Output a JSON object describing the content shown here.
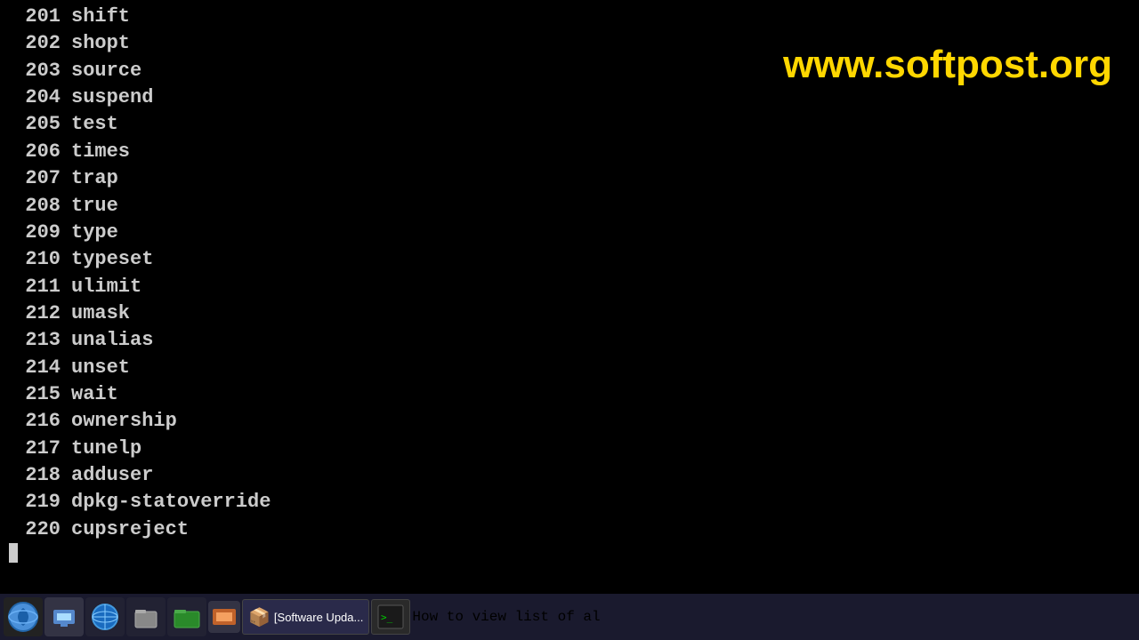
{
  "watermark": "www.softpost.org",
  "terminal": {
    "lines": [
      {
        "num": "201",
        "cmd": "shift"
      },
      {
        "num": "202",
        "cmd": "shopt"
      },
      {
        "num": "203",
        "cmd": "source"
      },
      {
        "num": "204",
        "cmd": "suspend"
      },
      {
        "num": "205",
        "cmd": "test"
      },
      {
        "num": "206",
        "cmd": "times"
      },
      {
        "num": "207",
        "cmd": "trap"
      },
      {
        "num": "208",
        "cmd": "true"
      },
      {
        "num": "209",
        "cmd": "type"
      },
      {
        "num": "210",
        "cmd": "typeset"
      },
      {
        "num": "211",
        "cmd": "ulimit"
      },
      {
        "num": "212",
        "cmd": "umask"
      },
      {
        "num": "213",
        "cmd": "unalias"
      },
      {
        "num": "214",
        "cmd": "unset"
      },
      {
        "num": "215",
        "cmd": "wait"
      },
      {
        "num": "216",
        "cmd": "ownership"
      },
      {
        "num": "217",
        "cmd": "tunelp"
      },
      {
        "num": "218",
        "cmd": "adduser"
      },
      {
        "num": "219",
        "cmd": "dpkg-statoverride"
      },
      {
        "num": "220",
        "cmd": "cupsreject"
      }
    ]
  },
  "taskbar": {
    "taskbar_text": "How to view list of al"
  }
}
